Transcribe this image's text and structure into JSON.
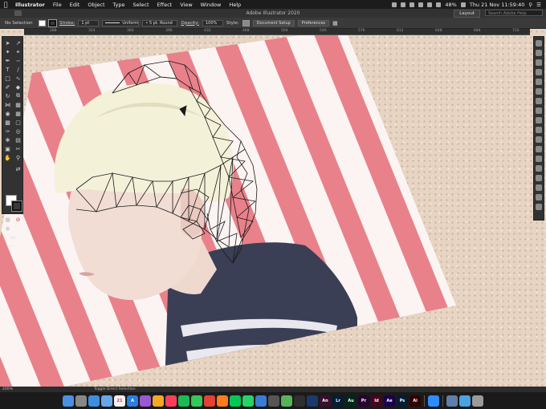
{
  "menubar": {
    "app": "Illustrator",
    "items": [
      "File",
      "Edit",
      "Object",
      "Type",
      "Select",
      "Effect",
      "View",
      "Window",
      "Help"
    ],
    "battery": "48%",
    "clock": "Thu 21 Nov  11:59:40"
  },
  "titlebar": {
    "title": "Adobe Illustrator 2020",
    "workspace": "Layout",
    "search_placeholder": "Search Adobe Help"
  },
  "controlbar": {
    "selection": "No Selection",
    "stroke_label": "Stroke:",
    "stroke_weight": "1 pt",
    "profile": "Uniform",
    "brush": "5 pt. Round",
    "opacity_label": "Opacity:",
    "opacity": "100%",
    "style_label": "Style:",
    "document_setup": "Document Setup",
    "preferences": "Preferences"
  },
  "ruler": [
    "288",
    "324",
    "360",
    "396",
    "432",
    "468",
    "504",
    "540",
    "576",
    "612",
    "648",
    "684",
    "720"
  ],
  "statusbar": {
    "zoom": "200%",
    "tool": "Toggle Direct Selection"
  },
  "colors": {
    "stripe_red": "#e9818a",
    "stripe_white": "#fbf4f2",
    "cork": "#e7d4c2",
    "panel": "#323232"
  },
  "dock": [
    {
      "name": "finder",
      "label": "",
      "color": "#4a90e2"
    },
    {
      "name": "launchpad",
      "label": "",
      "color": "#888888"
    },
    {
      "name": "safari",
      "label": "",
      "color": "#3b8ee0"
    },
    {
      "name": "mail",
      "label": "",
      "color": "#6aa5e8"
    },
    {
      "name": "calendar",
      "label": "21",
      "color": "#f2f2f2"
    },
    {
      "name": "app-store",
      "label": "A",
      "color": "#2a7de1"
    },
    {
      "name": "podcasts",
      "label": "",
      "color": "#9b59d0"
    },
    {
      "name": "photos",
      "label": "",
      "color": "#f5a623"
    },
    {
      "name": "music",
      "label": "",
      "color": "#fa3e5a"
    },
    {
      "name": "spotify",
      "label": "",
      "color": "#1db954"
    },
    {
      "name": "messages",
      "label": "",
      "color": "#34c759"
    },
    {
      "name": "chrome",
      "label": "",
      "color": "#e34133"
    },
    {
      "name": "firefox",
      "label": "",
      "color": "#ff7b1c"
    },
    {
      "name": "line",
      "label": "",
      "color": "#06c755"
    },
    {
      "name": "whatsapp",
      "label": "",
      "color": "#25d366"
    },
    {
      "name": "keynote",
      "label": "",
      "color": "#3a7bd5"
    },
    {
      "name": "calculator",
      "label": "",
      "color": "#555555"
    },
    {
      "name": "maps",
      "label": "",
      "color": "#59b25a"
    },
    {
      "name": "adobe-bridge",
      "label": "",
      "color": "#2f2f2f"
    },
    {
      "name": "cinema-4d",
      "label": "",
      "color": "#1b3a6b"
    },
    {
      "name": "animate",
      "label": "An",
      "color": "#3a0f2e"
    },
    {
      "name": "lightroom",
      "label": "Lr",
      "color": "#001e36"
    },
    {
      "name": "audition",
      "label": "Au",
      "color": "#00271a"
    },
    {
      "name": "premiere",
      "label": "Pr",
      "color": "#2a0034"
    },
    {
      "name": "indesign",
      "label": "Id",
      "color": "#49021f"
    },
    {
      "name": "after-effects",
      "label": "Ae",
      "color": "#1a004d"
    },
    {
      "name": "photoshop",
      "label": "Ps",
      "color": "#001e36"
    },
    {
      "name": "illustrator",
      "label": "Ai",
      "color": "#330000"
    },
    {
      "name": "zoom",
      "label": "",
      "color": "#2d8cff"
    },
    {
      "name": "downloads",
      "label": "",
      "color": "#5f7fa8"
    },
    {
      "name": "folder",
      "label": "",
      "color": "#4aa3e0"
    },
    {
      "name": "trash",
      "label": "",
      "color": "#9a9a9a"
    }
  ]
}
